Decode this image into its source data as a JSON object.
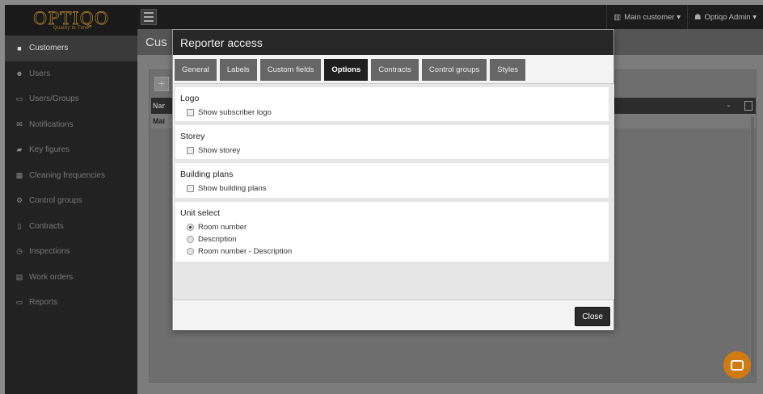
{
  "logo": {
    "name": "OPTIQO",
    "tagline": "Quality in Time"
  },
  "sidebar": {
    "items": [
      {
        "label": "Customers",
        "icon": "briefcase-icon",
        "glyph": "■",
        "active": true
      },
      {
        "label": "Users",
        "icon": "users-icon",
        "glyph": "☻",
        "active": false
      },
      {
        "label": "Users/Groups",
        "icon": "id-card-icon",
        "glyph": "▭",
        "active": false
      },
      {
        "label": "Notifications",
        "icon": "envelope-icon",
        "glyph": "✉",
        "active": false
      },
      {
        "label": "Key figures",
        "icon": "book-icon",
        "glyph": "▰",
        "active": false
      },
      {
        "label": "Cleaning frequencies",
        "icon": "calculator-icon",
        "glyph": "▦",
        "active": false
      },
      {
        "label": "Control groups",
        "icon": "cogs-icon",
        "glyph": "⚙",
        "active": false
      },
      {
        "label": "Contracts",
        "icon": "document-icon",
        "glyph": "▯",
        "active": false
      },
      {
        "label": "Inspections",
        "icon": "clock-icon",
        "glyph": "◷",
        "active": false
      },
      {
        "label": "Work orders",
        "icon": "inbox-icon",
        "glyph": "▤",
        "active": false
      },
      {
        "label": "Reports",
        "icon": "monitor-icon",
        "glyph": "▭",
        "active": false
      }
    ]
  },
  "topbar": {
    "customer_menu": "Main customer",
    "user_menu": "Optiqo Admin"
  },
  "content": {
    "title": "Cus",
    "grid_header_text": "Nar",
    "grid_row_text": "Mai"
  },
  "modal": {
    "title": "Reporter access",
    "tabs": [
      {
        "label": "General",
        "active": false
      },
      {
        "label": "Labels",
        "active": false
      },
      {
        "label": "Custom fields",
        "active": false
      },
      {
        "label": "Options",
        "active": true
      },
      {
        "label": "Contracts",
        "active": false
      },
      {
        "label": "Control groups",
        "active": false
      },
      {
        "label": "Styles",
        "active": false
      }
    ],
    "sections": {
      "logo": {
        "title": "Logo",
        "option": "Show subscriber logo",
        "checked": false
      },
      "storey": {
        "title": "Storey",
        "option": "Show storey",
        "checked": false
      },
      "building_plans": {
        "title": "Building plans",
        "option": "Show building plans",
        "checked": false
      },
      "unit_select": {
        "title": "Unit select",
        "options": [
          {
            "label": "Room number",
            "checked": true
          },
          {
            "label": "Description",
            "checked": false
          },
          {
            "label": "Room number - Description",
            "checked": false
          }
        ]
      }
    },
    "close_label": "Close"
  },
  "colors": {
    "accent_orange": "#d07a12",
    "logo_gold": "#b9892c",
    "sidebar_bg": "#222222",
    "modal_header": "#272727"
  }
}
